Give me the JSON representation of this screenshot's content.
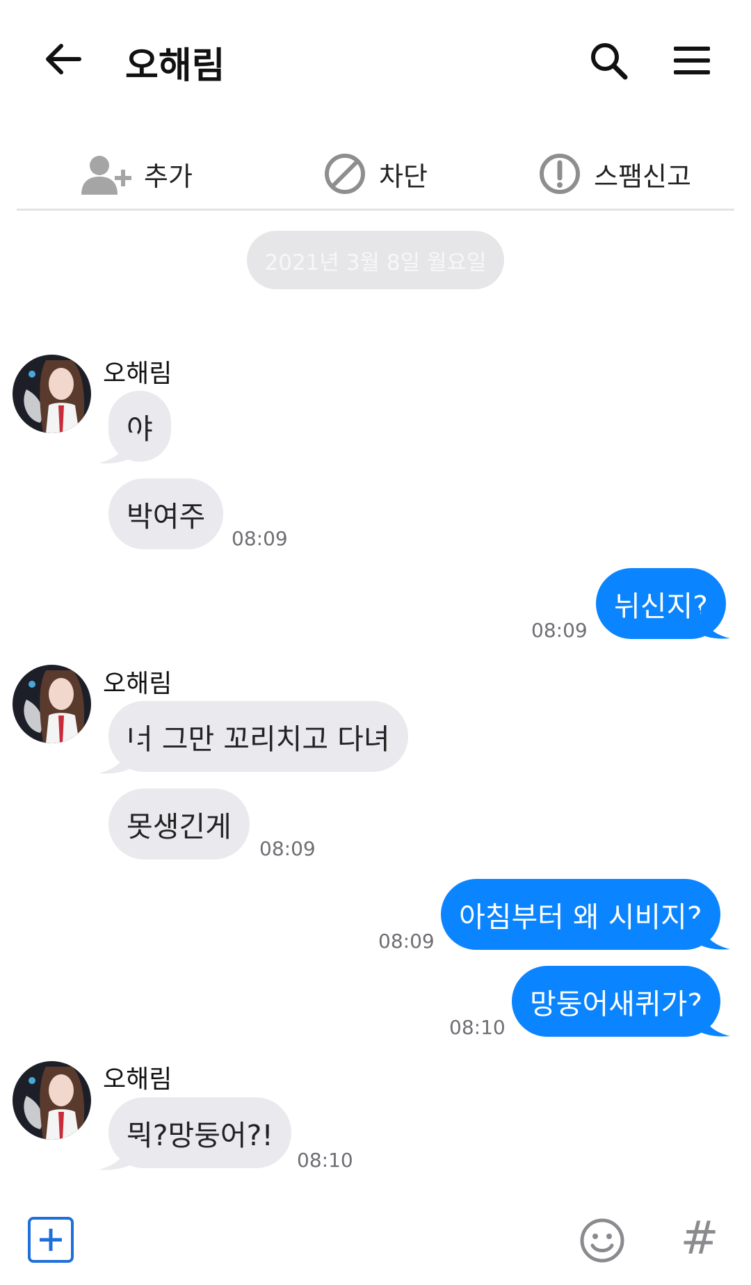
{
  "header": {
    "title": "오해림",
    "back_icon": "arrow-left-icon",
    "search_icon": "search-icon",
    "menu_icon": "hamburger-menu-icon"
  },
  "actions": [
    {
      "label": "추가",
      "icon": "add-contact-icon"
    },
    {
      "label": "차단",
      "icon": "block-icon"
    },
    {
      "label": "스팸신고",
      "icon": "alert-circle-icon"
    }
  ],
  "date_separator": "2021년 3월 8일 월요일",
  "colors": {
    "outgoing_bubble": "#0a84ff",
    "incoming_bubble": "#e9e9ee",
    "date_pill": "#e6e6e9",
    "plus_button": "#1e6fd9"
  },
  "messages": [
    {
      "direction": "in",
      "sender": "오해림",
      "text": "야"
    },
    {
      "direction": "in",
      "text": "박여주",
      "time": "08:09"
    },
    {
      "direction": "out",
      "text": "뉘신지?",
      "time": "08:09"
    },
    {
      "direction": "in",
      "sender": "오해림",
      "text": "너 그만 꼬리치고 다녀"
    },
    {
      "direction": "in",
      "text": "못생긴게",
      "time": "08:09"
    },
    {
      "direction": "out",
      "text": "아침부터 왜 시비지?",
      "time": "08:09"
    },
    {
      "direction": "out",
      "text": "망둥어새퀴가?",
      "time": "08:10"
    },
    {
      "direction": "in",
      "sender": "오해림",
      "text": "뭐?망둥어?!",
      "time": "08:10"
    }
  ],
  "bottom_bar": {
    "attach_icon": "plus-square-icon",
    "emoji_icon": "smiley-icon",
    "hashtag_label": "#"
  }
}
